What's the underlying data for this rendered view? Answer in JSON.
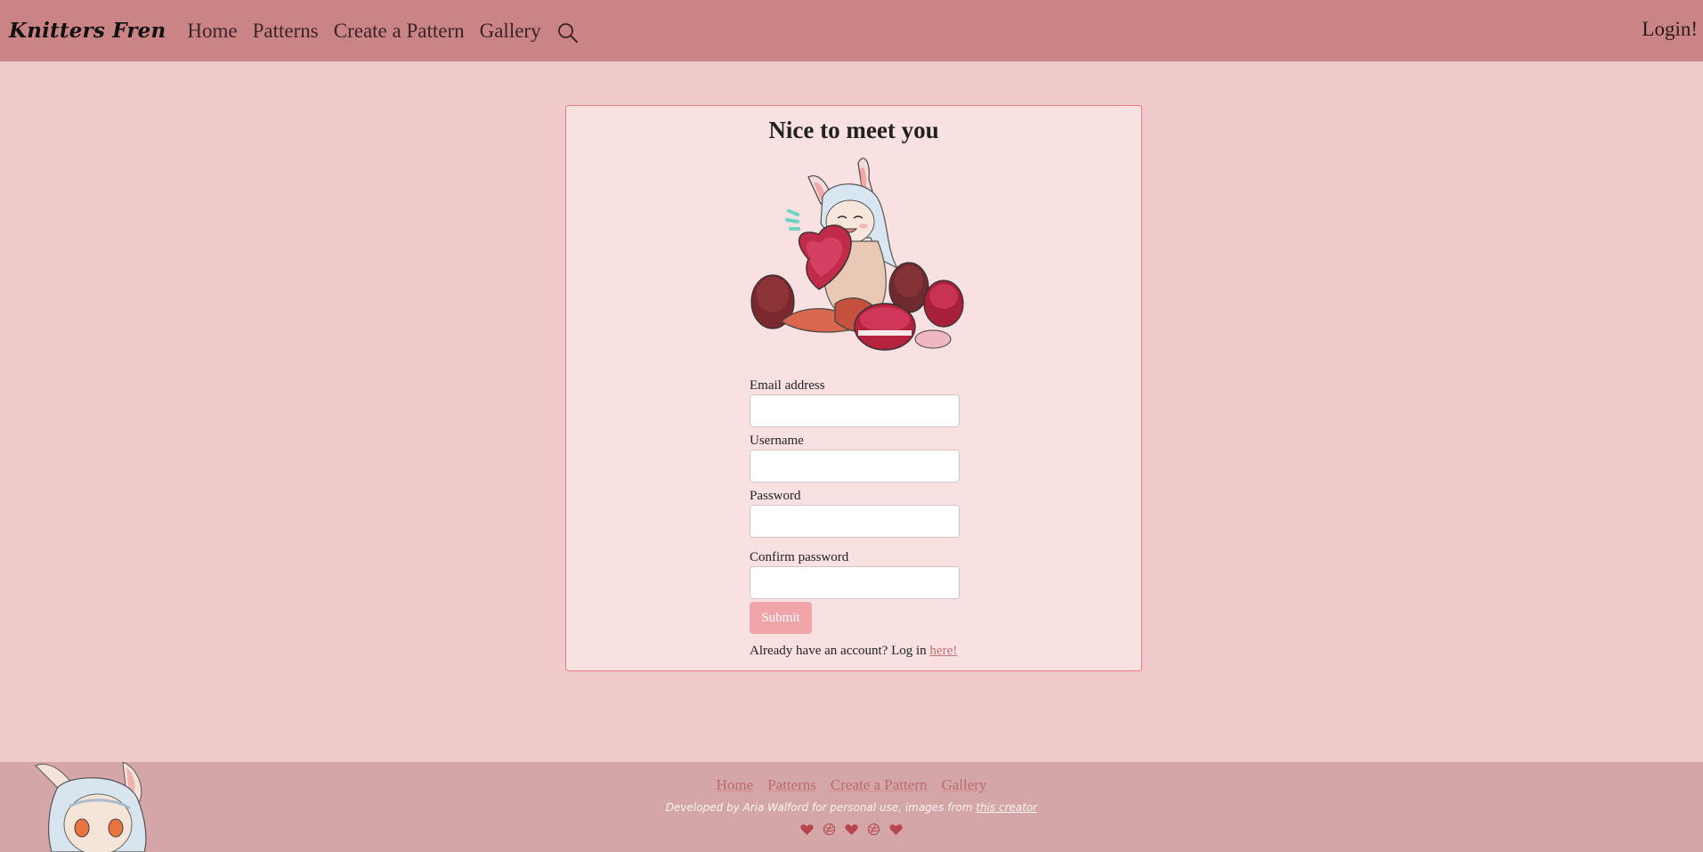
{
  "navbar": {
    "brand": "Knitters Fren",
    "links": [
      "Home",
      "Patterns",
      "Create a Pattern",
      "Gallery"
    ],
    "search_icon": "search-icon",
    "login": "Login!"
  },
  "signup": {
    "title": "Nice to meet you",
    "illustration": "bunny-girl-with-macarons-illustration",
    "fields": [
      {
        "label": "Email address",
        "value": "",
        "placeholder": ""
      },
      {
        "label": "Username",
        "value": "",
        "placeholder": ""
      },
      {
        "label": "Password",
        "value": "",
        "placeholder": ""
      },
      {
        "label": "Confirm password",
        "value": "",
        "placeholder": ""
      }
    ],
    "submit_label": "Submit",
    "login_prompt": "Already have an account? Log in",
    "login_link": "here!"
  },
  "footer": {
    "links": [
      "Home",
      "Patterns",
      "Create a Pattern",
      "Gallery"
    ],
    "credit_text": "Developed by Aria Walford for personal use, images from",
    "credit_link": "this creator",
    "icons": [
      "heart-icon",
      "yarn-icon",
      "heart-icon",
      "yarn-icon",
      "heart-icon"
    ]
  },
  "colors": {
    "navbar_bg": "#cb8485",
    "page_bg": "#f0cacb",
    "card_bg": "#f9e1e2",
    "card_border": "#de7d80",
    "button_bg": "#f0a6a9",
    "footer_bg": "#d4a6a8",
    "icon_color": "#b5464d"
  }
}
